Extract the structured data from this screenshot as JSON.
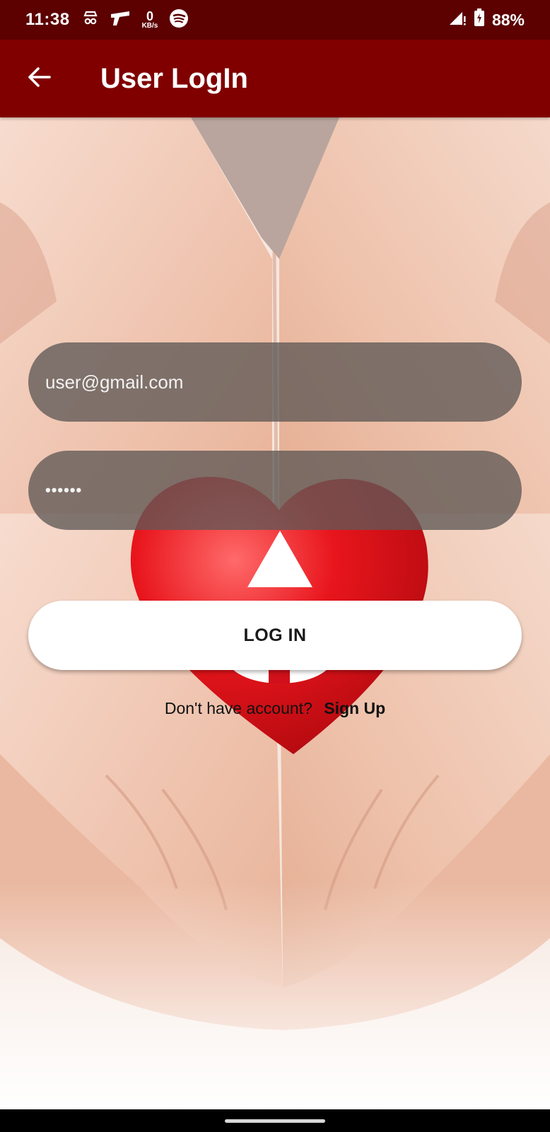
{
  "status_bar": {
    "time": "11:38",
    "net_speed_value": "0",
    "net_speed_unit": "KB/s",
    "battery": "88%",
    "icons": [
      "incognito-icon",
      "gun-icon",
      "spotify-icon",
      "signal-icon",
      "battery-icon"
    ]
  },
  "app_bar": {
    "title": "User LogIn",
    "back_icon": "arrow-left-icon",
    "color": "#800000"
  },
  "form": {
    "email_value": "user@gmail.com",
    "password_masked": "••••••",
    "login_label": "LOG IN",
    "no_account_text": "Don't have account?",
    "signup_label": "Sign Up"
  },
  "colors": {
    "status_bar": "#5c0000",
    "app_bar": "#800000",
    "field_bg": "rgba(95,88,86,0.78)",
    "heart_red": "#e3141b"
  }
}
